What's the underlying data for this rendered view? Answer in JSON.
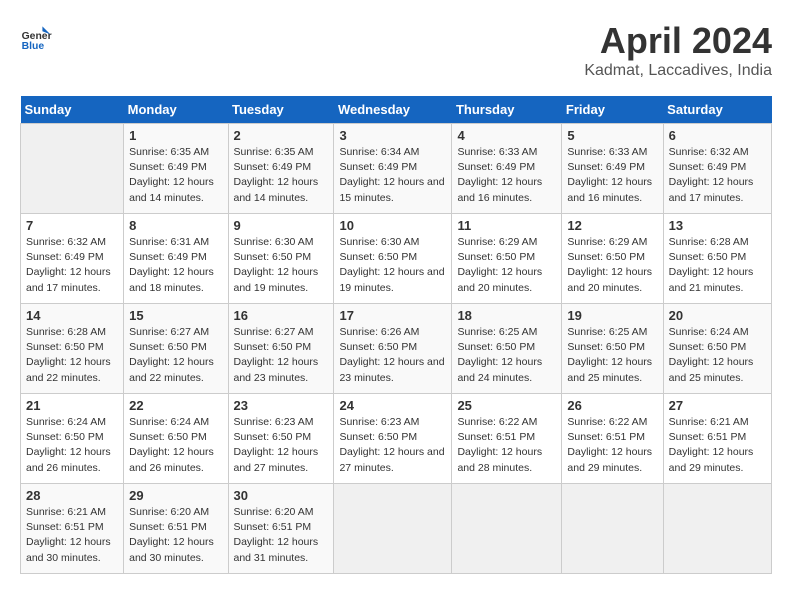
{
  "header": {
    "logo_line1": "General",
    "logo_line2": "Blue",
    "month": "April 2024",
    "location": "Kadmat, Laccadives, India"
  },
  "weekdays": [
    "Sunday",
    "Monday",
    "Tuesday",
    "Wednesday",
    "Thursday",
    "Friday",
    "Saturday"
  ],
  "weeks": [
    [
      {
        "day": "",
        "empty": true
      },
      {
        "day": "1",
        "sunrise": "6:35 AM",
        "sunset": "6:49 PM",
        "daylight": "12 hours and 14 minutes."
      },
      {
        "day": "2",
        "sunrise": "6:35 AM",
        "sunset": "6:49 PM",
        "daylight": "12 hours and 14 minutes."
      },
      {
        "day": "3",
        "sunrise": "6:34 AM",
        "sunset": "6:49 PM",
        "daylight": "12 hours and 15 minutes."
      },
      {
        "day": "4",
        "sunrise": "6:33 AM",
        "sunset": "6:49 PM",
        "daylight": "12 hours and 16 minutes."
      },
      {
        "day": "5",
        "sunrise": "6:33 AM",
        "sunset": "6:49 PM",
        "daylight": "12 hours and 16 minutes."
      },
      {
        "day": "6",
        "sunrise": "6:32 AM",
        "sunset": "6:49 PM",
        "daylight": "12 hours and 17 minutes."
      }
    ],
    [
      {
        "day": "7",
        "sunrise": "6:32 AM",
        "sunset": "6:49 PM",
        "daylight": "12 hours and 17 minutes."
      },
      {
        "day": "8",
        "sunrise": "6:31 AM",
        "sunset": "6:49 PM",
        "daylight": "12 hours and 18 minutes."
      },
      {
        "day": "9",
        "sunrise": "6:30 AM",
        "sunset": "6:50 PM",
        "daylight": "12 hours and 19 minutes."
      },
      {
        "day": "10",
        "sunrise": "6:30 AM",
        "sunset": "6:50 PM",
        "daylight": "12 hours and 19 minutes."
      },
      {
        "day": "11",
        "sunrise": "6:29 AM",
        "sunset": "6:50 PM",
        "daylight": "12 hours and 20 minutes."
      },
      {
        "day": "12",
        "sunrise": "6:29 AM",
        "sunset": "6:50 PM",
        "daylight": "12 hours and 20 minutes."
      },
      {
        "day": "13",
        "sunrise": "6:28 AM",
        "sunset": "6:50 PM",
        "daylight": "12 hours and 21 minutes."
      }
    ],
    [
      {
        "day": "14",
        "sunrise": "6:28 AM",
        "sunset": "6:50 PM",
        "daylight": "12 hours and 22 minutes."
      },
      {
        "day": "15",
        "sunrise": "6:27 AM",
        "sunset": "6:50 PM",
        "daylight": "12 hours and 22 minutes."
      },
      {
        "day": "16",
        "sunrise": "6:27 AM",
        "sunset": "6:50 PM",
        "daylight": "12 hours and 23 minutes."
      },
      {
        "day": "17",
        "sunrise": "6:26 AM",
        "sunset": "6:50 PM",
        "daylight": "12 hours and 23 minutes."
      },
      {
        "day": "18",
        "sunrise": "6:25 AM",
        "sunset": "6:50 PM",
        "daylight": "12 hours and 24 minutes."
      },
      {
        "day": "19",
        "sunrise": "6:25 AM",
        "sunset": "6:50 PM",
        "daylight": "12 hours and 25 minutes."
      },
      {
        "day": "20",
        "sunrise": "6:24 AM",
        "sunset": "6:50 PM",
        "daylight": "12 hours and 25 minutes."
      }
    ],
    [
      {
        "day": "21",
        "sunrise": "6:24 AM",
        "sunset": "6:50 PM",
        "daylight": "12 hours and 26 minutes."
      },
      {
        "day": "22",
        "sunrise": "6:24 AM",
        "sunset": "6:50 PM",
        "daylight": "12 hours and 26 minutes."
      },
      {
        "day": "23",
        "sunrise": "6:23 AM",
        "sunset": "6:50 PM",
        "daylight": "12 hours and 27 minutes."
      },
      {
        "day": "24",
        "sunrise": "6:23 AM",
        "sunset": "6:50 PM",
        "daylight": "12 hours and 27 minutes."
      },
      {
        "day": "25",
        "sunrise": "6:22 AM",
        "sunset": "6:51 PM",
        "daylight": "12 hours and 28 minutes."
      },
      {
        "day": "26",
        "sunrise": "6:22 AM",
        "sunset": "6:51 PM",
        "daylight": "12 hours and 29 minutes."
      },
      {
        "day": "27",
        "sunrise": "6:21 AM",
        "sunset": "6:51 PM",
        "daylight": "12 hours and 29 minutes."
      }
    ],
    [
      {
        "day": "28",
        "sunrise": "6:21 AM",
        "sunset": "6:51 PM",
        "daylight": "12 hours and 30 minutes."
      },
      {
        "day": "29",
        "sunrise": "6:20 AM",
        "sunset": "6:51 PM",
        "daylight": "12 hours and 30 minutes."
      },
      {
        "day": "30",
        "sunrise": "6:20 AM",
        "sunset": "6:51 PM",
        "daylight": "12 hours and 31 minutes."
      },
      {
        "day": "",
        "empty": true
      },
      {
        "day": "",
        "empty": true
      },
      {
        "day": "",
        "empty": true
      },
      {
        "day": "",
        "empty": true
      }
    ]
  ]
}
